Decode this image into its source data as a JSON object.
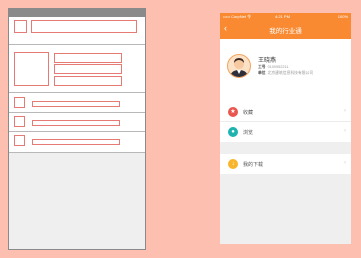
{
  "colors": {
    "background": "#fdc0b0",
    "accent": "#fa8a32",
    "wire_border": "#e57b74",
    "icon_red": "#e8574f",
    "icon_teal": "#1fb3b0",
    "icon_yellow": "#f8b52b"
  },
  "phone": {
    "status_left": "••••• CorpNet 令",
    "status_time": "4:21 PM",
    "status_right": "100%",
    "back_icon": "chevron-left-icon",
    "title": "我的行业通"
  },
  "profile": {
    "name": "王晓燕",
    "id_label": "工号",
    "id_value": "0100952211",
    "company_label": "单位",
    "company_value": "北京建筑信息科技有限公司",
    "avatar_icon": "user-avatar-icon"
  },
  "menu": [
    {
      "label": "收藏",
      "icon": "favorites-icon",
      "glyph": "★"
    },
    {
      "label": "浏览",
      "icon": "history-icon",
      "glyph": "●"
    }
  ],
  "menu2": [
    {
      "label": "我的下载",
      "icon": "download-icon",
      "glyph": "↓"
    }
  ]
}
